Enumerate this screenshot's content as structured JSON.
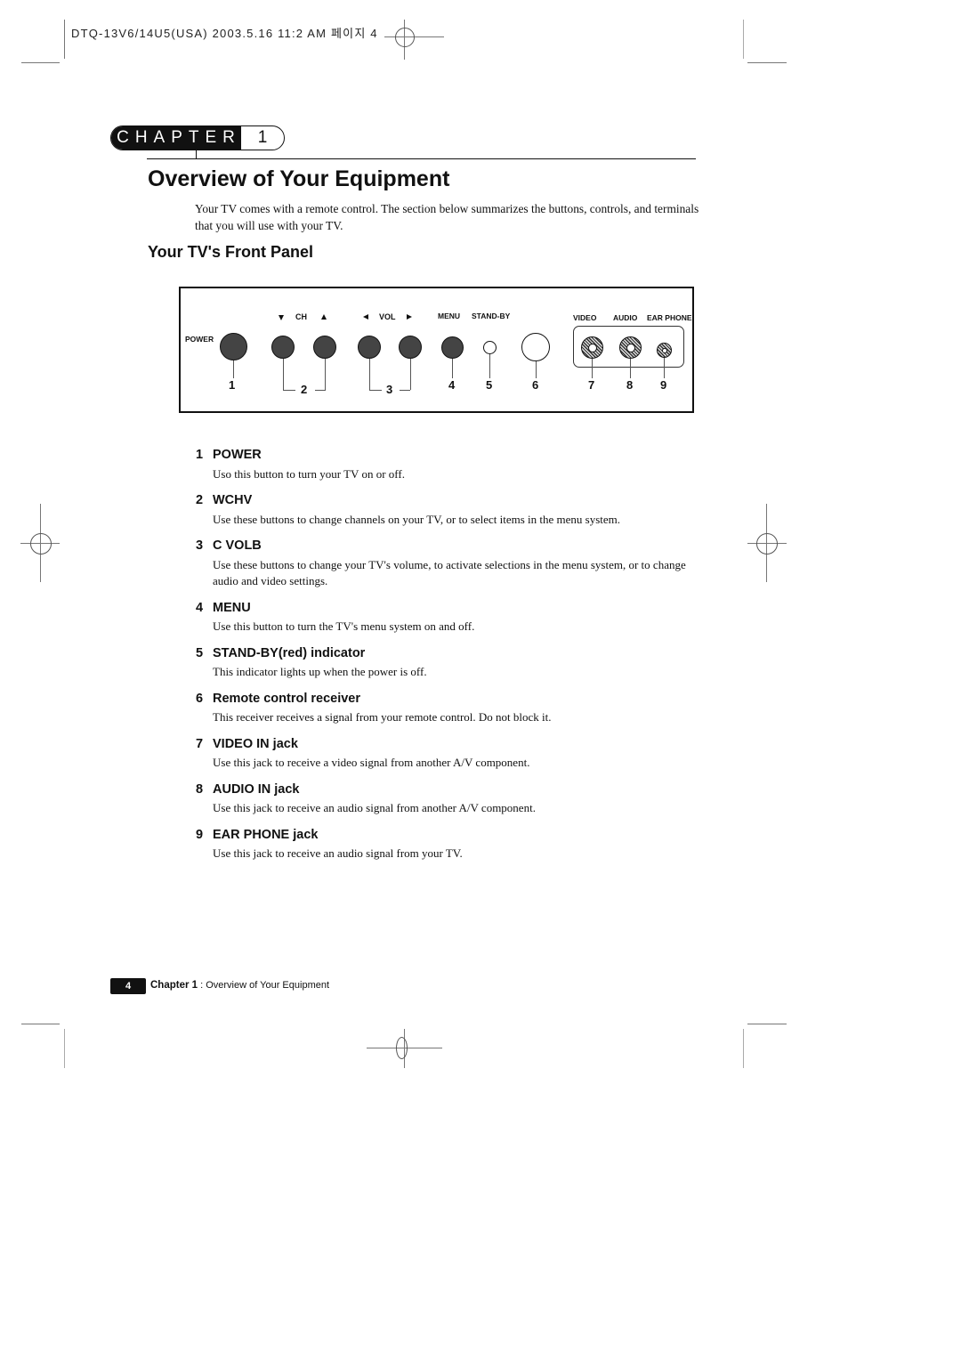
{
  "print_slug": "DTQ-13V6/14U5(USA)  2003.5.16 11:2 AM   페이지 4",
  "chapter": {
    "label": "CHAPTER",
    "number": "1"
  },
  "title": "Overview of Your Equipment",
  "intro": "Your TV comes with a remote control. The section below summarizes the buttons, controls, and terminals that you will use with your TV.",
  "section_title": "Your TV's Front Panel",
  "panel": {
    "labels": {
      "power": "POWER",
      "ch": "CH",
      "vol": "VOL",
      "menu": "MENU",
      "standby": "STAND-BY",
      "video": "VIDEO",
      "audio": "AUDIO",
      "earphone": "EAR PHONE"
    },
    "icons": {
      "ch_down": "triangle-down-icon",
      "ch_up": "triangle-up-icon",
      "vol_left": "triangle-left-icon",
      "vol_right": "triangle-right-icon"
    },
    "callouts": [
      "1",
      "2",
      "3",
      "4",
      "5",
      "6",
      "7",
      "8",
      "9"
    ]
  },
  "items": [
    {
      "num": "1",
      "name": "POWER",
      "desc": "Uso this button to turn your TV on or off."
    },
    {
      "num": "2",
      "name": "WCHV",
      "desc": "Use these buttons to change channels on your TV, or to select items in the menu system."
    },
    {
      "num": "3",
      "name": "C VOLB",
      "desc": "Use these buttons to change your TV's volume, to activate selections in the menu system, or to change audio and video settings."
    },
    {
      "num": "4",
      "name": "MENU",
      "desc": "Use this button to turn the TV's menu system on and off."
    },
    {
      "num": "5",
      "name": "STAND-BY(red) indicator",
      "desc": "This indicator lights up when the power is off."
    },
    {
      "num": "6",
      "name": "Remote control receiver",
      "desc": "This receiver receives a signal from your remote control. Do not block it."
    },
    {
      "num": "7",
      "name": "VIDEO IN jack",
      "desc": "Use this jack to receive a video signal from another A/V component."
    },
    {
      "num": "8",
      "name": "AUDIO IN jack",
      "desc": "Use this jack to receive an audio signal from another A/V component."
    },
    {
      "num": "9",
      "name": "EAR PHONE jack",
      "desc": "Use this jack to receive an audio signal from your TV."
    }
  ],
  "footer": {
    "page": "4",
    "chapter": "Chapter 1",
    "separator": " : ",
    "title": "Overview of Your Equipment"
  }
}
